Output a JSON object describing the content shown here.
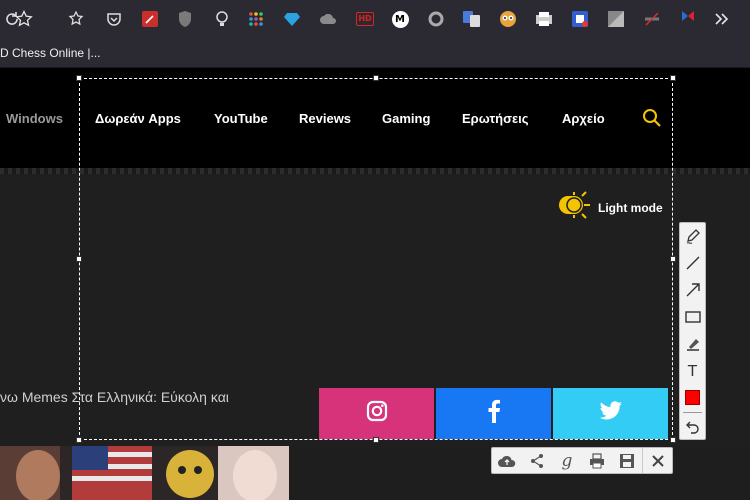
{
  "browser": {
    "bookmark_label": "D Chess Online |...",
    "toolbar_icons": [
      "reload-icon",
      "star-icon",
      "extensions-icon",
      "pocket-icon",
      "wand-extension-icon",
      "ublock-icon",
      "bulb-icon",
      "grid-icon",
      "gem-icon",
      "cloud-icon",
      "hd-icon",
      "m-icon",
      "circle-icon",
      "translate-icon",
      "owl-icon",
      "printer-icon",
      "shield-icon",
      "square-icon",
      "muted-icon",
      "flag-icon",
      "overflow-icon"
    ],
    "hd_label": "HD",
    "m_label": "M"
  },
  "nav": {
    "items": [
      {
        "label": "Windows"
      },
      {
        "label": "Δωρεάν Apps"
      },
      {
        "label": "YouTube"
      },
      {
        "label": "Reviews"
      },
      {
        "label": "Gaming"
      },
      {
        "label": "Ερωτήσεις"
      },
      {
        "label": "Αρχείο"
      }
    ]
  },
  "theme_toggle": {
    "label": "Light mode"
  },
  "article": {
    "headline": "νω Memes Στα Ελληνικά: Εύκολη και"
  },
  "social": [
    {
      "name": "instagram",
      "color": "#d6337b"
    },
    {
      "name": "facebook",
      "color": "#1877f2"
    },
    {
      "name": "twitter",
      "color": "#33ccf5"
    }
  ],
  "draw_tools": [
    "pen-icon",
    "line-icon",
    "arrow-icon",
    "rectangle-icon",
    "highlighter-icon",
    "text-icon",
    "color-swatch-icon",
    "undo-icon"
  ],
  "draw_text_tool": "T",
  "draw_color": "#ff0000",
  "bottom_tools": [
    "cloud-upload-icon",
    "share-icon",
    "google-icon",
    "print-icon",
    "save-icon",
    "close-icon"
  ],
  "bottom_google_label": "g",
  "colors": {
    "accent": "#f5c400",
    "nav_bg": "#000000",
    "page_bg": "#1f1f1f"
  }
}
